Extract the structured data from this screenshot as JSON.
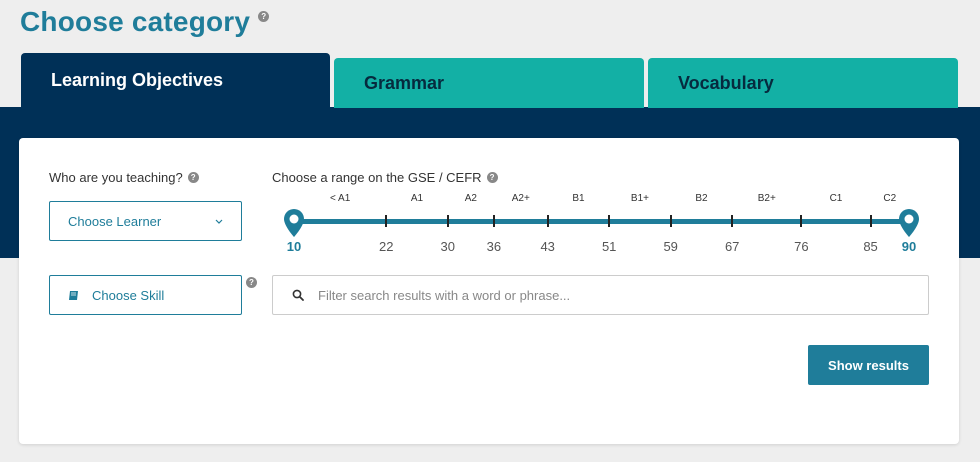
{
  "header": {
    "title": "Choose category",
    "help_icon": "question-circle-icon"
  },
  "tabs": [
    {
      "label": "Learning Objectives",
      "active": true
    },
    {
      "label": "Grammar",
      "active": false
    },
    {
      "label": "Vocabulary",
      "active": false
    }
  ],
  "learner": {
    "label": "Who are you teaching?",
    "button_label": "Choose Learner"
  },
  "skill": {
    "button_label": "Choose Skill"
  },
  "range": {
    "label": "Choose a range on the GSE / CEFR",
    "min": 10,
    "max": 90,
    "selected_min": "10",
    "selected_max": "90",
    "levels": [
      {
        "label": "< A1",
        "at": 16
      },
      {
        "label": "A1",
        "at": 26
      },
      {
        "label": "A2",
        "at": 33
      },
      {
        "label": "A2+",
        "at": 39.5
      },
      {
        "label": "B1",
        "at": 47
      },
      {
        "label": "B1+",
        "at": 55
      },
      {
        "label": "B2",
        "at": 63
      },
      {
        "label": "B2+",
        "at": 71.5
      },
      {
        "label": "C1",
        "at": 80.5
      },
      {
        "label": "C2",
        "at": 87.5
      }
    ],
    "ticks": [
      22,
      30,
      36,
      43,
      51,
      59,
      67,
      76,
      85
    ],
    "tick_labels": [
      "22",
      "30",
      "36",
      "43",
      "51",
      "59",
      "67",
      "76",
      "85"
    ]
  },
  "search": {
    "placeholder": "Filter search results with a word or phrase...",
    "value": ""
  },
  "actions": {
    "show_results": "Show results"
  },
  "colors": {
    "accent": "#1f7d9a",
    "navy": "#003057",
    "teal": "#13b0a5"
  }
}
